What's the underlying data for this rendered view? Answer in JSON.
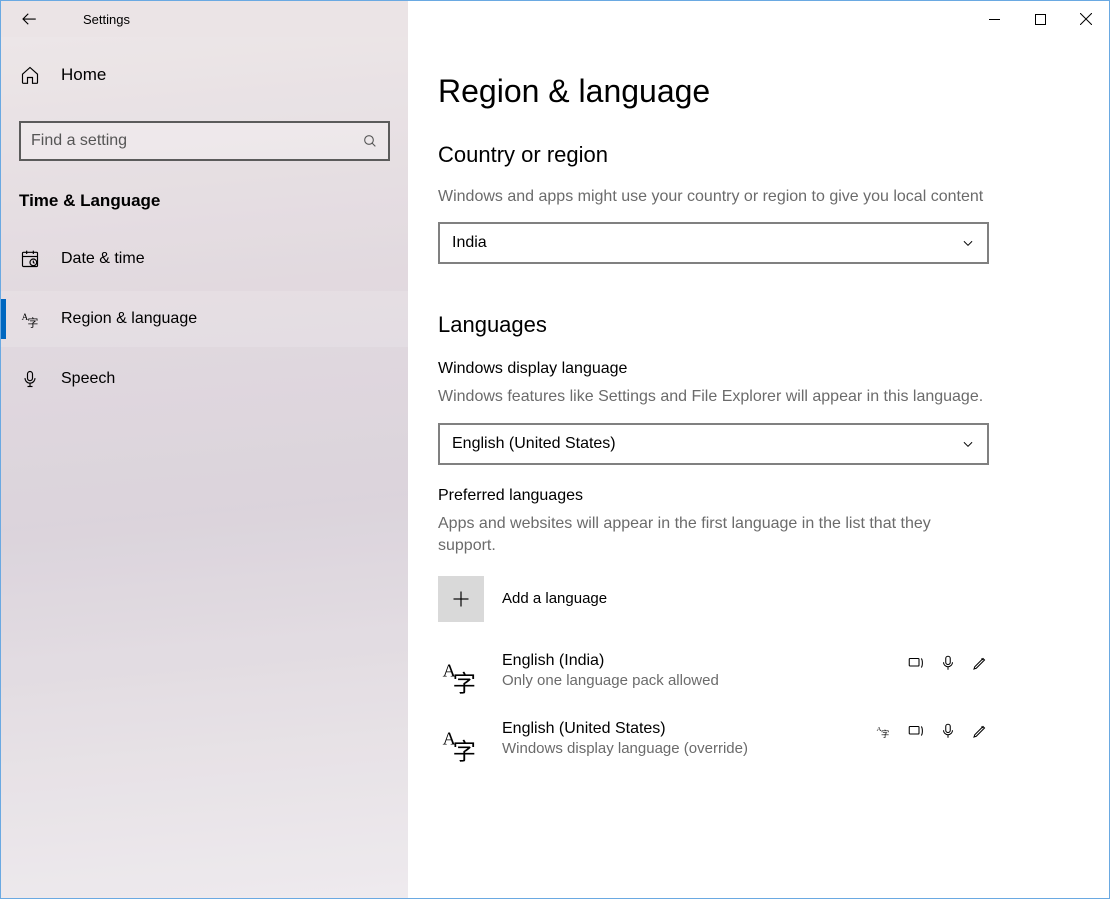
{
  "window": {
    "title": "Settings"
  },
  "sidebar": {
    "home": "Home",
    "search_placeholder": "Find a setting",
    "group": "Time & Language",
    "items": [
      {
        "label": "Date & time"
      },
      {
        "label": "Region & language"
      },
      {
        "label": "Speech"
      }
    ]
  },
  "page": {
    "title": "Region & language",
    "region": {
      "heading": "Country or region",
      "desc": "Windows and apps might use your country or region to give you local content",
      "value": "India"
    },
    "languages": {
      "heading": "Languages",
      "display": {
        "sub": "Windows display language",
        "desc": "Windows features like Settings and File Explorer will appear in this language.",
        "value": "English (United States)"
      },
      "preferred": {
        "sub": "Preferred languages",
        "desc": "Apps and websites will appear in the first language in the list that they support.",
        "add": "Add a language",
        "items": [
          {
            "name": "English (India)",
            "sub": "Only one language pack allowed"
          },
          {
            "name": "English (United States)",
            "sub": "Windows display language (override)"
          }
        ]
      }
    }
  }
}
